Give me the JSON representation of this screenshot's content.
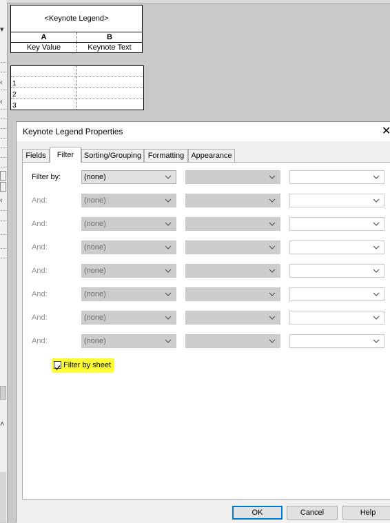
{
  "schedule": {
    "title": "<Keynote Legend>",
    "col_a": "A",
    "col_b": "B",
    "head_a": "Key Value",
    "head_b": "Keynote Text",
    "rows": [
      "",
      "1",
      "2",
      "3"
    ]
  },
  "dialog": {
    "title": "Keynote Legend Properties",
    "close": "✕",
    "tabs": [
      "Fields",
      "Filter",
      "Sorting/Grouping",
      "Formatting",
      "Appearance"
    ],
    "active_tab": "Filter",
    "filter_by_label": "Filter by:",
    "and_label": "And:",
    "none_value": "(none)",
    "filter_rows": 8,
    "filter_by_sheet_label": "Filter by sheet",
    "filter_by_sheet_checked": true,
    "ok": "OK",
    "cancel": "Cancel",
    "help": "Help"
  },
  "colors": {
    "highlight": "#ffff33",
    "ok_border": "#0078d7"
  }
}
